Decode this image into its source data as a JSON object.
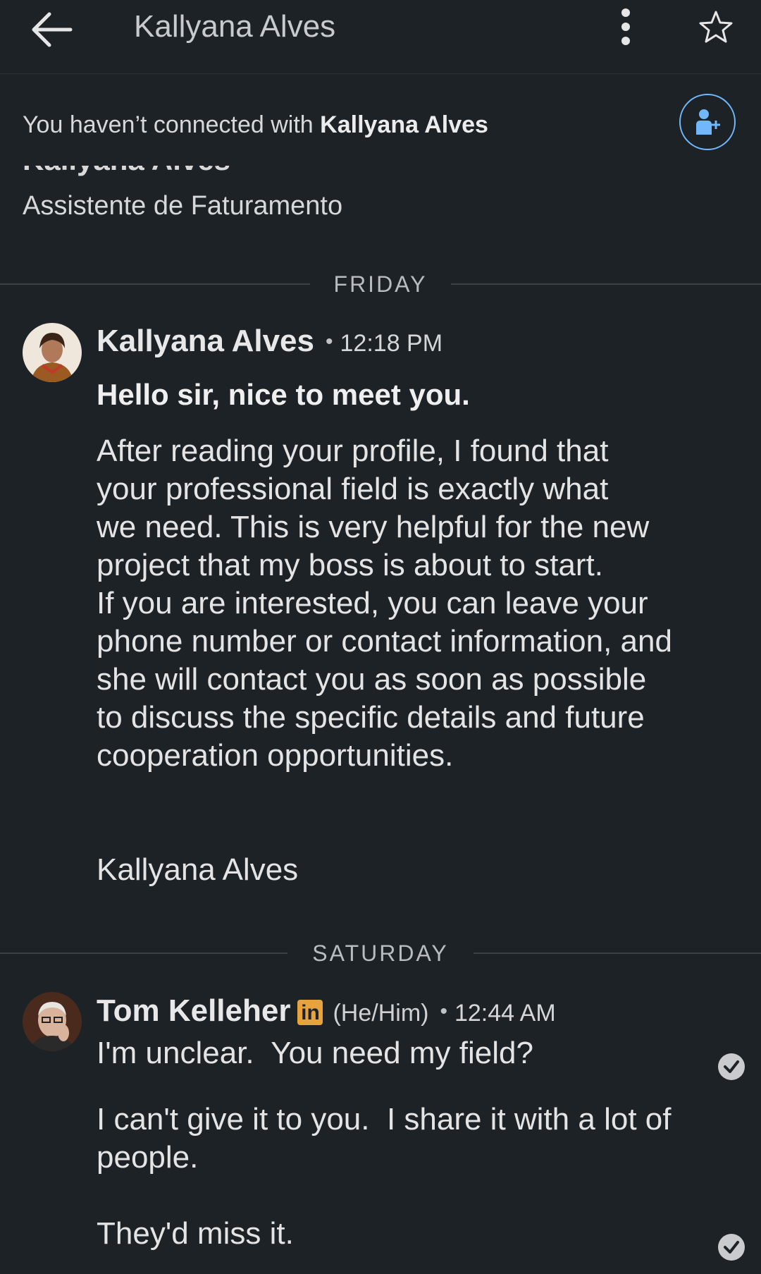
{
  "topbar": {
    "title": "Kallyana Alves",
    "icons": [
      "back-arrow-icon",
      "more-vertical-icon",
      "star-icon"
    ]
  },
  "connect_banner": {
    "prefix": "You haven’t connected with ",
    "name": "Kallyana Alves",
    "icon": "add-person-icon"
  },
  "profile": {
    "name": "Kallyana Alves",
    "headline": "Assistente de Faturamento"
  },
  "dividers": {
    "friday": "FRIDAY",
    "saturday": "SATURDAY"
  },
  "message1": {
    "sender": "Kallyana Alves",
    "time": "12:18 PM",
    "subject": "Hello sir, nice to meet you.",
    "body": "After reading your profile, I found that\nyour professional field is exactly what\nwe need. This is very helpful for the new\nproject that my boss is about to start.\nIf you are interested, you can leave your\nphone number or contact information, and\nshe will contact you as soon as possible\nto discuss the specific details and future\ncooperation opportunities.",
    "signature": "Kallyana Alves"
  },
  "message2": {
    "sender": "Tom Kelleher",
    "badge": "in",
    "pronouns": "(He/Him)",
    "time": "12:44 AM",
    "line1": "I'm unclear.  You need my field?",
    "line2": "I can't give it to you.  I share it with a lot of\npeople.",
    "line3": "They'd miss it."
  },
  "colors": {
    "background": "#1d2226",
    "accent_blue": "#71b7fb",
    "linkedin_badge": "#e7a33e"
  }
}
